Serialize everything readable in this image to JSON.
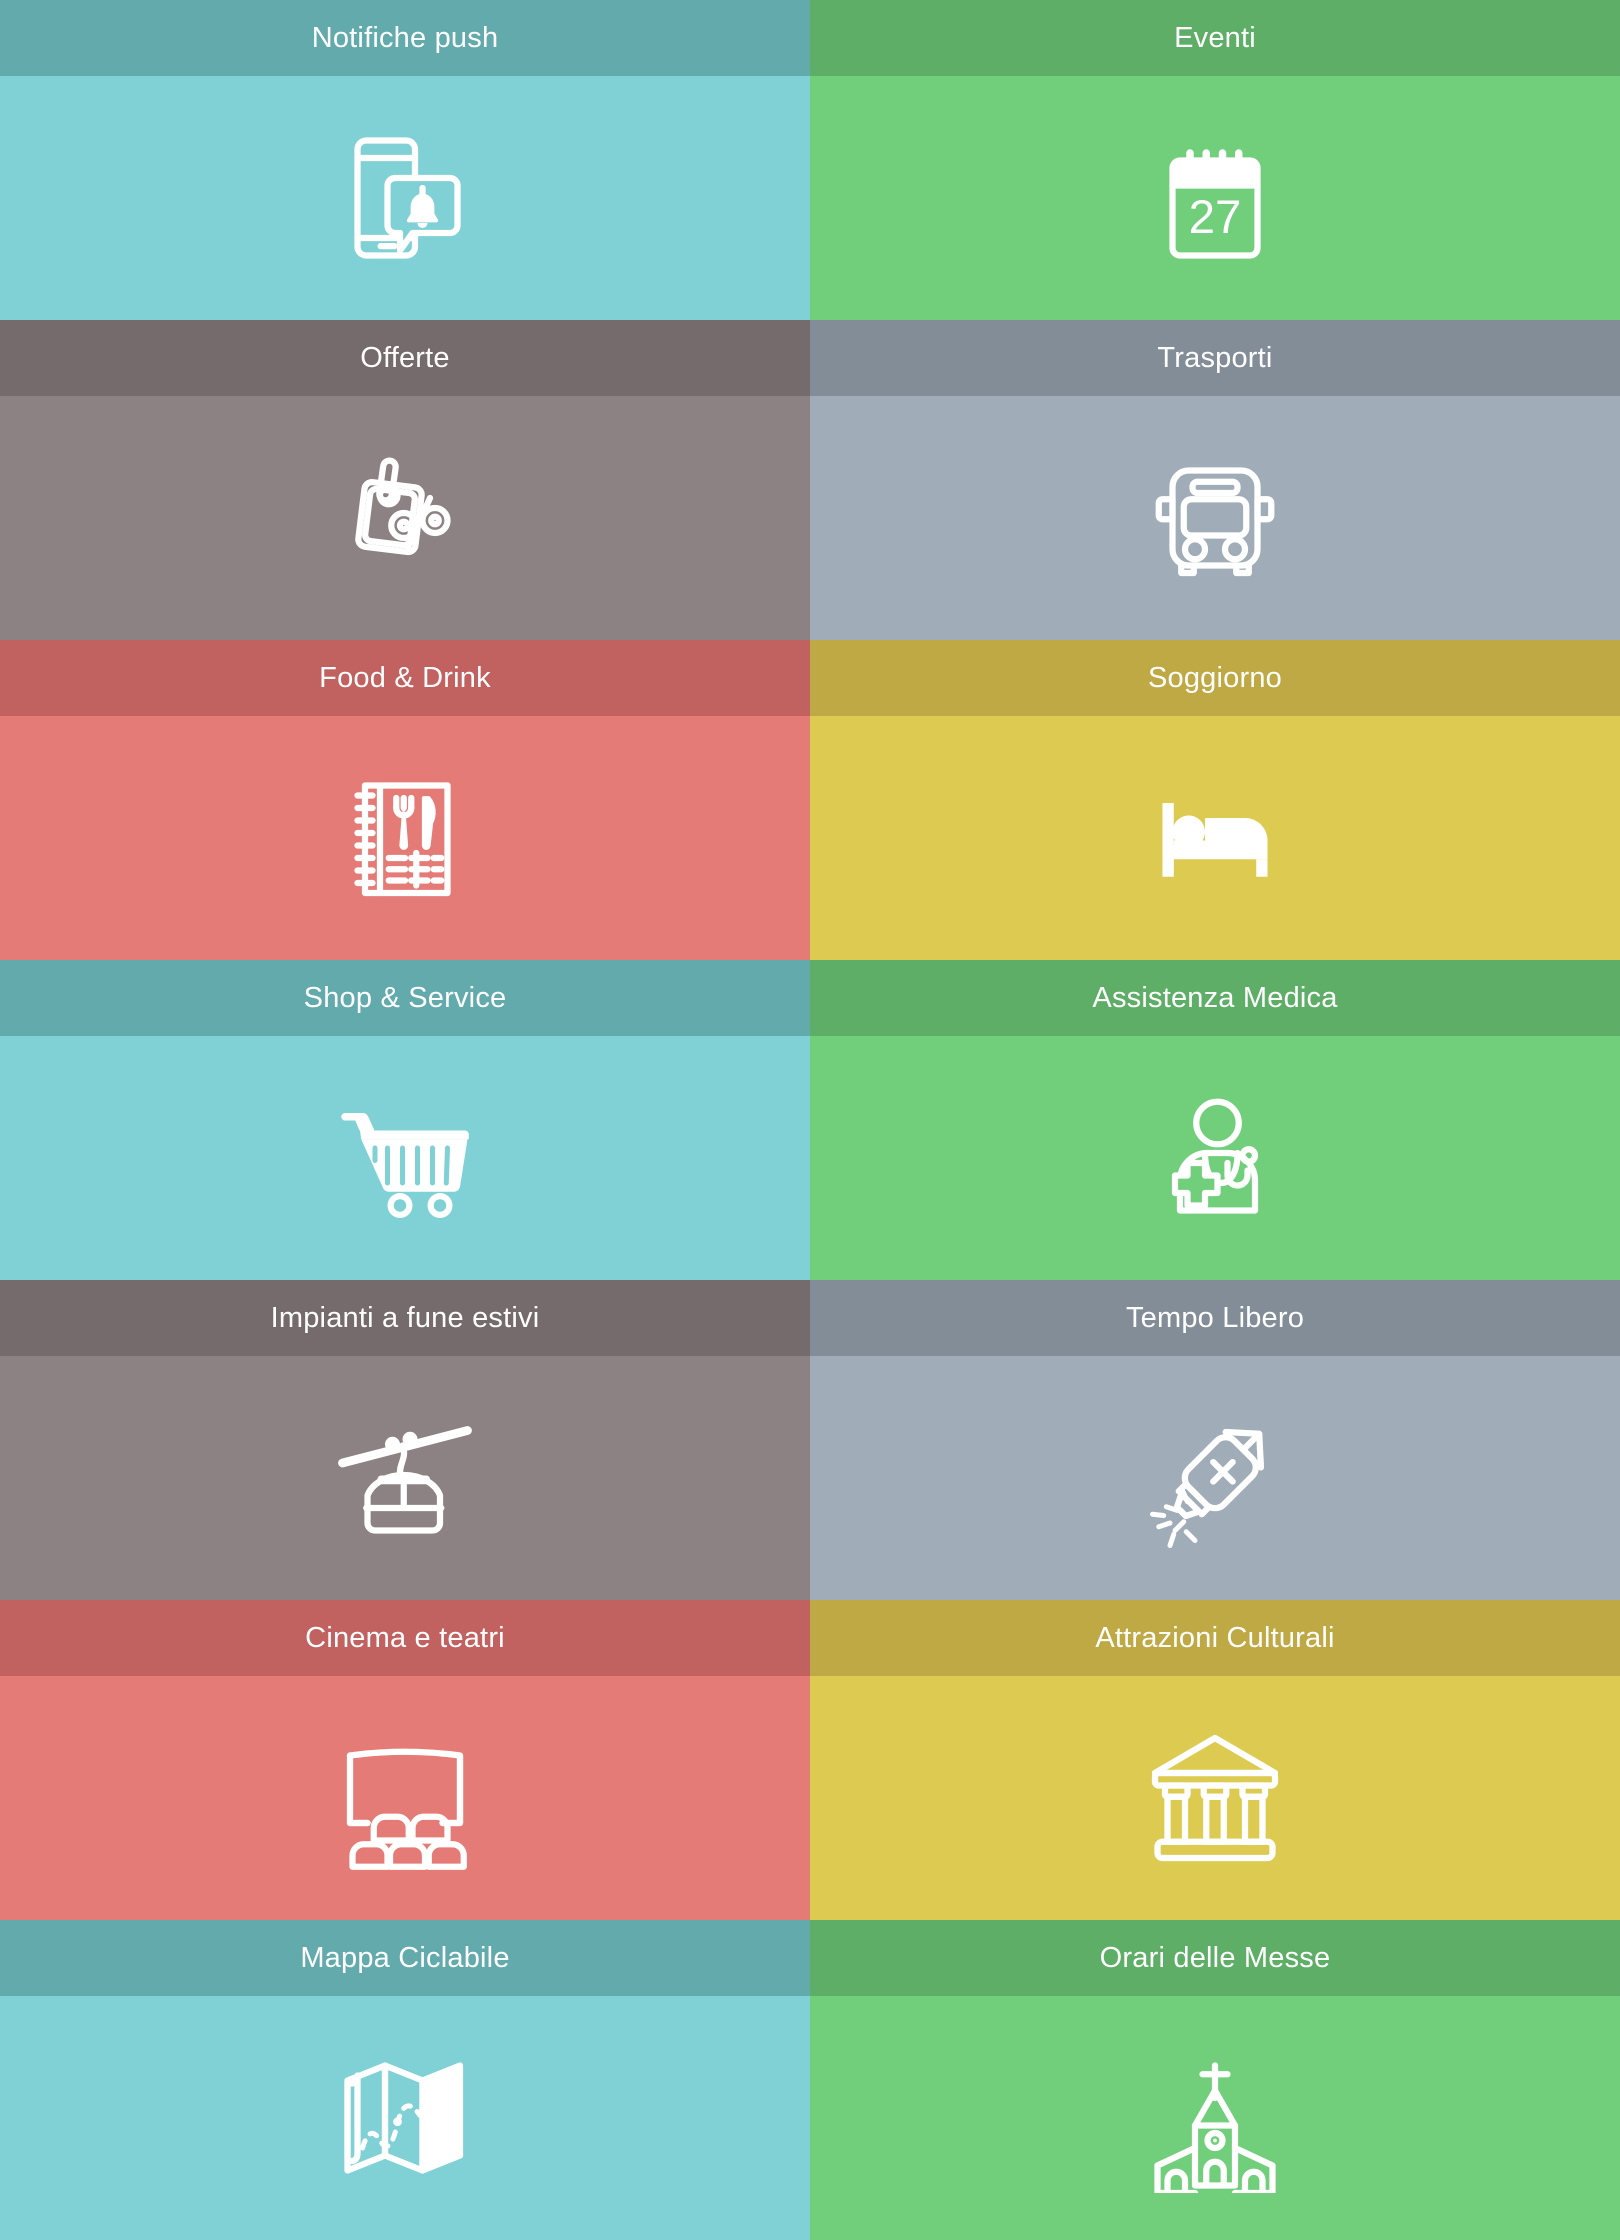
{
  "app": {
    "layout": "tile-grid",
    "columns": 2,
    "language": "it"
  },
  "palette": {
    "teal_header": "#63aaad",
    "teal_body": "#7fd1d5",
    "green_header": "#5fae67",
    "green_body": "#71ce7b",
    "brown_header": "#756b6c",
    "brown_body": "#8d8283",
    "slate_header": "#838d97",
    "slate_body": "#a0adb8",
    "red_header": "#c16160",
    "red_body": "#e57b76",
    "gold_header": "#bfa944",
    "gold_body": "#ddcb51",
    "label_color": "#ffffff",
    "icon_color": "#ffffff"
  },
  "tiles": [
    {
      "label": "Notifiche push",
      "icon": "push-notification-icon",
      "header_color": "#63aaad",
      "body_color": "#7fd1d5"
    },
    {
      "label": "Eventi",
      "icon": "calendar-icon",
      "icon_text": "27",
      "header_color": "#5fae67",
      "body_color": "#71ce7b"
    },
    {
      "label": "Offerte",
      "icon": "discount-tag-icon",
      "header_color": "#756b6c",
      "body_color": "#8d8283"
    },
    {
      "label": "Trasporti",
      "icon": "bus-icon",
      "header_color": "#838d97",
      "body_color": "#a0adb8"
    },
    {
      "label": "Food & Drink",
      "icon": "restaurant-menu-icon",
      "header_color": "#c16160",
      "body_color": "#e57b76"
    },
    {
      "label": "Soggiorno",
      "icon": "bed-icon",
      "header_color": "#bfa944",
      "body_color": "#ddcb51"
    },
    {
      "label": "Shop & Service",
      "icon": "shopping-cart-icon",
      "header_color": "#63aaad",
      "body_color": "#7fd1d5"
    },
    {
      "label": "Assistenza Medica",
      "icon": "doctor-icon",
      "header_color": "#5fae67",
      "body_color": "#71ce7b"
    },
    {
      "label": "Impianti a fune estivi",
      "icon": "cable-car-icon",
      "header_color": "#756b6c",
      "body_color": "#8d8283"
    },
    {
      "label": "Tempo Libero",
      "icon": "firework-rocket-icon",
      "header_color": "#838d97",
      "body_color": "#a0adb8"
    },
    {
      "label": "Cinema e teatri",
      "icon": "cinema-screen-icon",
      "header_color": "#c16160",
      "body_color": "#e57b76"
    },
    {
      "label": "Attrazioni Culturali",
      "icon": "museum-icon",
      "header_color": "#bfa944",
      "body_color": "#ddcb51"
    },
    {
      "label": "Mappa Ciclabile",
      "icon": "folded-map-icon",
      "header_color": "#63aaad",
      "body_color": "#7fd1d5"
    },
    {
      "label": "Orari delle Messe",
      "icon": "church-icon",
      "header_color": "#5fae67",
      "body_color": "#71ce7b"
    }
  ]
}
